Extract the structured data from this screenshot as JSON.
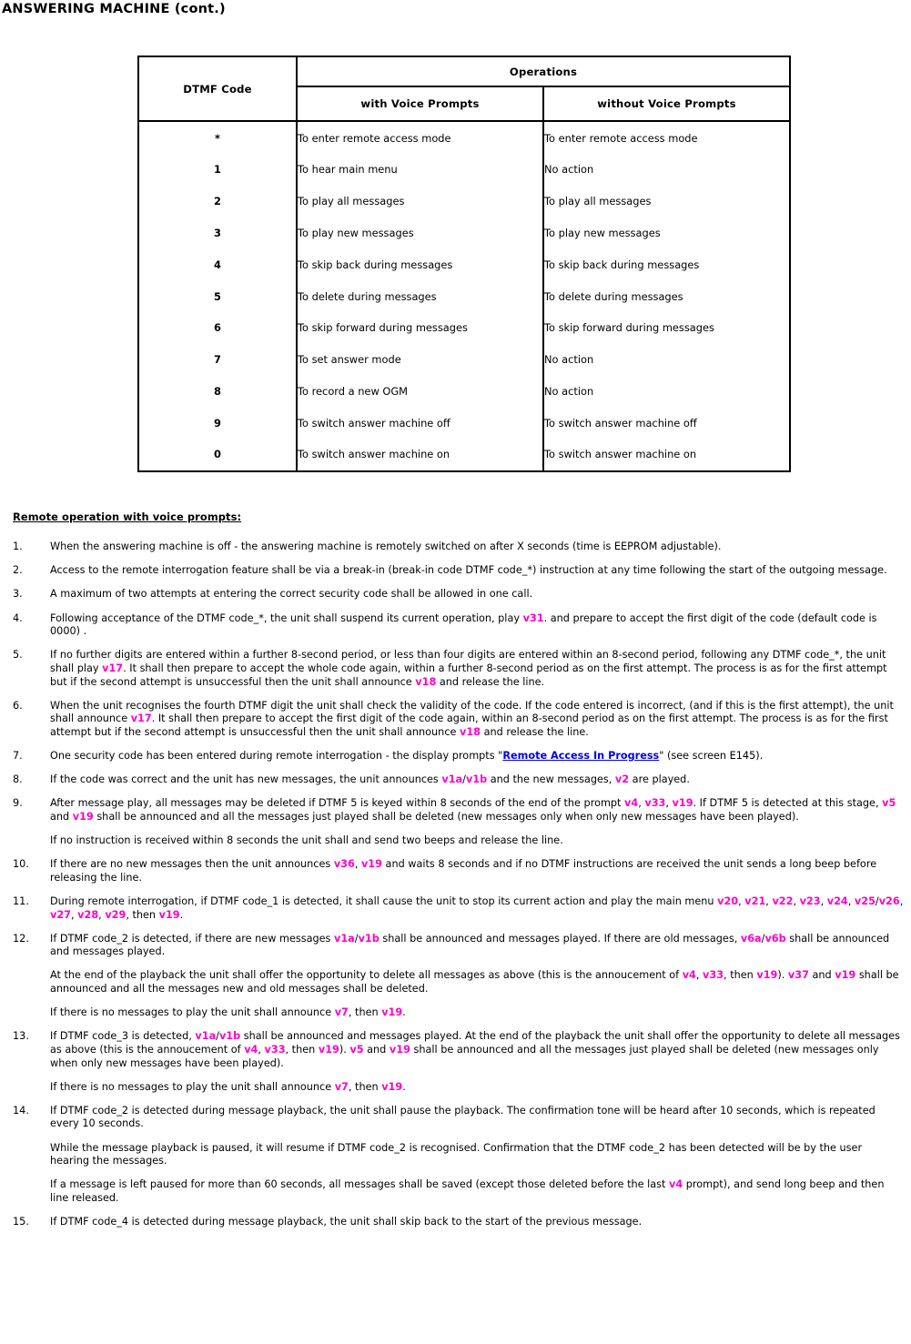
{
  "colors": {
    "voice_prompt_code": "#ff00cc",
    "screen_ref": "#0000ee",
    "text": "#000000",
    "border": "#000000"
  },
  "document": {
    "title": "ANSWERING MACHINE (cont.)"
  },
  "table": {
    "header": {
      "col_code": "DTMF Code",
      "group": "Operations",
      "sub_with": "with Voice Prompts",
      "sub_without": "without Voice Prompts"
    },
    "rows": [
      {
        "code": "*",
        "with": "To enter remote access mode",
        "without": "To enter remote access mode"
      },
      {
        "code": "1",
        "with": "To hear main menu",
        "without": "No action"
      },
      {
        "code": "2",
        "with": "To play all messages",
        "without": "To play all messages"
      },
      {
        "code": "3",
        "with": "To play new messages",
        "without": "To play new messages"
      },
      {
        "code": "4",
        "with": "To skip back during messages",
        "without": "To skip back during messages"
      },
      {
        "code": "5",
        "with": "To delete during messages",
        "without": "To delete during messages"
      },
      {
        "code": "6",
        "with": "To skip forward during messages",
        "without": "To skip forward during messages"
      },
      {
        "code": "7",
        "with": "To set answer mode",
        "without": "No action"
      },
      {
        "code": "8",
        "with": "To record a new OGM",
        "without": "No action"
      },
      {
        "code": "9",
        "with": "To switch answer machine off",
        "without": "To switch answer machine off"
      },
      {
        "code": "0",
        "with": "To switch answer machine on",
        "without": "To switch answer machine on"
      }
    ]
  },
  "section": {
    "heading_underlined": "Remote operation with voice prompts",
    "heading_colon": ":"
  },
  "steps": [
    {
      "num": "1.",
      "paragraphs": [
        [
          {
            "t": "When the answering machine is off - the answering machine is remotely switched on after X seconds (time is EEPROM adjustable)."
          }
        ]
      ]
    },
    {
      "num": "2.",
      "paragraphs": [
        [
          {
            "t": "Access to the remote interrogation feature shall be via a break-in (break-in code DTMF code_*) instruction at any time following the start of the outgoing message."
          }
        ]
      ]
    },
    {
      "num": "3.",
      "paragraphs": [
        [
          {
            "t": "A maximum of two attempts at entering the correct security code shall be allowed in one call."
          }
        ]
      ]
    },
    {
      "num": "4.",
      "paragraphs": [
        [
          {
            "t": "Following acceptance of the DTMF code_*, the unit shall suspend its current operation, play "
          },
          {
            "t": "v31",
            "s": "v"
          },
          {
            "t": ". and prepare to accept the first digit of the code (default code is 0000) ."
          }
        ]
      ]
    },
    {
      "num": "5.",
      "paragraphs": [
        [
          {
            "t": "If no further digits are entered within a further 8-second period, or less than four digits are entered within an 8-second period, following any DTMF code_*, the unit shall play "
          },
          {
            "t": "v17",
            "s": "v"
          },
          {
            "t": ". It shall then prepare to accept the whole code again, within a further 8-second period as on the first attempt. The process is as for the first attempt but if the second attempt is unsuccessful then the unit shall announce "
          },
          {
            "t": "v18",
            "s": "v"
          },
          {
            "t": " and release the line."
          }
        ]
      ]
    },
    {
      "num": "6.",
      "paragraphs": [
        [
          {
            "t": "When the unit recognises the fourth DTMF digit the unit shall check the validity of the code. If the code entered is incorrect, (and if this is the first attempt), the unit shall announce "
          },
          {
            "t": "v17",
            "s": "v"
          },
          {
            "t": ". It shall then prepare to accept the first digit of the code again, within an 8-second period as on the first attempt. The process is as for the first attempt but if the second attempt is unsuccessful then the unit shall announce "
          },
          {
            "t": "v18",
            "s": "v"
          },
          {
            "t": " and release the line."
          }
        ]
      ]
    },
    {
      "num": "7.",
      "paragraphs": [
        [
          {
            "t": "One security code has been entered during remote interrogation - the display prompts \""
          },
          {
            "t": "Remote Access In Progress",
            "s": "b"
          },
          {
            "t": "\" (see screen E145)."
          }
        ]
      ]
    },
    {
      "num": "8.",
      "paragraphs": [
        [
          {
            "t": "If the code was correct and the unit has new messages, the unit announces "
          },
          {
            "t": "v1a",
            "s": "v"
          },
          {
            "t": "/"
          },
          {
            "t": "v1b",
            "s": "v"
          },
          {
            "t": " and the new messages, "
          },
          {
            "t": "v2",
            "s": "v"
          },
          {
            "t": " are played."
          }
        ]
      ]
    },
    {
      "num": "9.",
      "paragraphs": [
        [
          {
            "t": "After message play, all messages may be deleted if DTMF 5 is keyed within 8 seconds of the end of the prompt "
          },
          {
            "t": "v4",
            "s": "v"
          },
          {
            "t": ", "
          },
          {
            "t": "v33",
            "s": "v"
          },
          {
            "t": ", "
          },
          {
            "t": "v19",
            "s": "v"
          },
          {
            "t": ". If DTMF 5 is detected at this stage, "
          },
          {
            "t": "v5",
            "s": "v"
          },
          {
            "t": " and "
          },
          {
            "t": "v19",
            "s": "v"
          },
          {
            "t": " shall be announced and all the messages just played shall be deleted (new messages only when only new messages have been played)."
          }
        ],
        [
          {
            "t": "If no instruction is received within 8 seconds the unit shall and send two beeps and release the line."
          }
        ]
      ]
    },
    {
      "num": "10.",
      "paragraphs": [
        [
          {
            "t": "If there are no new messages then the unit announces "
          },
          {
            "t": "v36",
            "s": "v"
          },
          {
            "t": ", "
          },
          {
            "t": "v19",
            "s": "v"
          },
          {
            "t": " and waits 8 seconds and if no DTMF instructions are received the unit sends a long beep before releasing the line."
          }
        ]
      ]
    },
    {
      "num": "11.",
      "paragraphs": [
        [
          {
            "t": "During remote interrogation, if DTMF code_1 is detected, it shall cause the unit to stop its current action and play the main menu "
          },
          {
            "t": "v20",
            "s": "v"
          },
          {
            "t": ", "
          },
          {
            "t": "v21",
            "s": "v"
          },
          {
            "t": ", "
          },
          {
            "t": "v22",
            "s": "v"
          },
          {
            "t": ", "
          },
          {
            "t": "v23",
            "s": "v"
          },
          {
            "t": ", "
          },
          {
            "t": "v24",
            "s": "v"
          },
          {
            "t": ", "
          },
          {
            "t": "v25",
            "s": "v"
          },
          {
            "t": "/"
          },
          {
            "t": "v26",
            "s": "v"
          },
          {
            "t": ", "
          },
          {
            "t": "v27",
            "s": "v"
          },
          {
            "t": ", "
          },
          {
            "t": "v28",
            "s": "v"
          },
          {
            "t": ", "
          },
          {
            "t": "v29",
            "s": "v"
          },
          {
            "t": ", then "
          },
          {
            "t": "v19",
            "s": "v"
          },
          {
            "t": "."
          }
        ]
      ]
    },
    {
      "num": "12.",
      "paragraphs": [
        [
          {
            "t": "If DTMF code_2 is detected, if there are new messages "
          },
          {
            "t": "v1a",
            "s": "v"
          },
          {
            "t": "/"
          },
          {
            "t": "v1b",
            "s": "v"
          },
          {
            "t": " shall be announced and messages played. If there are old messages, "
          },
          {
            "t": "v6a",
            "s": "v"
          },
          {
            "t": "/"
          },
          {
            "t": "v6b",
            "s": "v"
          },
          {
            "t": " shall be announced and messages played."
          }
        ],
        [
          {
            "t": "At the end of the playback the unit shall offer the opportunity to delete all messages as above (this is the annoucement of "
          },
          {
            "t": "v4",
            "s": "v"
          },
          {
            "t": ", "
          },
          {
            "t": "v33",
            "s": "v"
          },
          {
            "t": ", then "
          },
          {
            "t": "v19",
            "s": "v"
          },
          {
            "t": "). "
          },
          {
            "t": "v37",
            "s": "v"
          },
          {
            "t": " and "
          },
          {
            "t": "v19",
            "s": "v"
          },
          {
            "t": " shall be announced and all the messages new and old messages shall be deleted."
          }
        ],
        [
          {
            "t": "If there is no messages to play the unit shall announce "
          },
          {
            "t": "v7",
            "s": "v"
          },
          {
            "t": ", then "
          },
          {
            "t": "v19",
            "s": "v"
          },
          {
            "t": "."
          }
        ]
      ]
    },
    {
      "num": "13.",
      "paragraphs": [
        [
          {
            "t": "If DTMF code_3 is detected, "
          },
          {
            "t": "v1a",
            "s": "v"
          },
          {
            "t": "/"
          },
          {
            "t": "v1b",
            "s": "v"
          },
          {
            "t": " shall be announced and messages played. At the end of the playback the unit shall offer the opportunity to delete all messages as above (this is the annoucement of "
          },
          {
            "t": "v4",
            "s": "v"
          },
          {
            "t": ", "
          },
          {
            "t": "v33",
            "s": "v"
          },
          {
            "t": ", then "
          },
          {
            "t": "v19",
            "s": "v"
          },
          {
            "t": "). "
          },
          {
            "t": "v5",
            "s": "v"
          },
          {
            "t": " and "
          },
          {
            "t": "v19",
            "s": "v"
          },
          {
            "t": " shall be announced and all the messages just played shall be deleted (new messages only when only new messages have been played)."
          }
        ],
        [
          {
            "t": "If there is no messages to play the unit shall announce "
          },
          {
            "t": "v7",
            "s": "v"
          },
          {
            "t": ", then "
          },
          {
            "t": "v19",
            "s": "v"
          },
          {
            "t": "."
          }
        ]
      ]
    },
    {
      "num": "14.",
      "paragraphs": [
        [
          {
            "t": "If DTMF code_2 is detected during message playback, the unit shall pause the playback. The confirmation tone will be heard after 10 seconds, which is repeated every 10 seconds."
          }
        ],
        [
          {
            "t": "While the message playback is paused, it will resume if DTMF code_2 is recognised. Confirmation that the DTMF code_2 has been detected will be by the user hearing the messages."
          }
        ],
        [
          {
            "t": "If a message is left paused for more than 60 seconds, all messages shall be saved (except those deleted before the last "
          },
          {
            "t": "v4",
            "s": "v"
          },
          {
            "t": " prompt), and send long beep and then line released."
          }
        ]
      ]
    },
    {
      "num": "15.",
      "paragraphs": [
        [
          {
            "t": "If DTMF code_4 is detected during message playback, the unit shall skip back to the start of the previous message."
          }
        ]
      ]
    }
  ]
}
